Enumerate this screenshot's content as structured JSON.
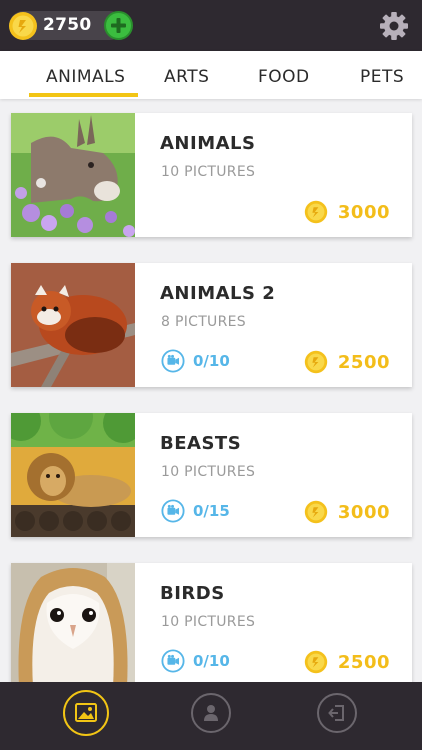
{
  "header": {
    "coins": "2750",
    "colors": {
      "bar": "#2e2930",
      "accent": "#f2c515",
      "plus": "#3bbd3f"
    }
  },
  "tabs": [
    {
      "label": "ANIMALS",
      "active": true
    },
    {
      "label": "ARTS",
      "active": false
    },
    {
      "label": "FOOD",
      "active": false
    },
    {
      "label": "PETS",
      "active": false
    }
  ],
  "categories": [
    {
      "title": "ANIMALS",
      "subtitle": "10 PICTURES",
      "video": "",
      "price": "3000",
      "image": "donkey-in-flowers"
    },
    {
      "title": "ANIMALS 2",
      "subtitle": "8 PICTURES",
      "video": "0/10",
      "price": "2500",
      "image": "red-panda"
    },
    {
      "title": "BEASTS",
      "subtitle": "10 PICTURES",
      "video": "0/15",
      "price": "3000",
      "image": "lion"
    },
    {
      "title": "BIRDS",
      "subtitle": "10 PICTURES",
      "video": "0/10",
      "price": "2500",
      "image": "barn-owl"
    }
  ],
  "bottom_nav": [
    {
      "icon": "gallery-icon",
      "active": true
    },
    {
      "icon": "profile-icon",
      "active": false
    },
    {
      "icon": "exit-icon",
      "active": false
    }
  ]
}
